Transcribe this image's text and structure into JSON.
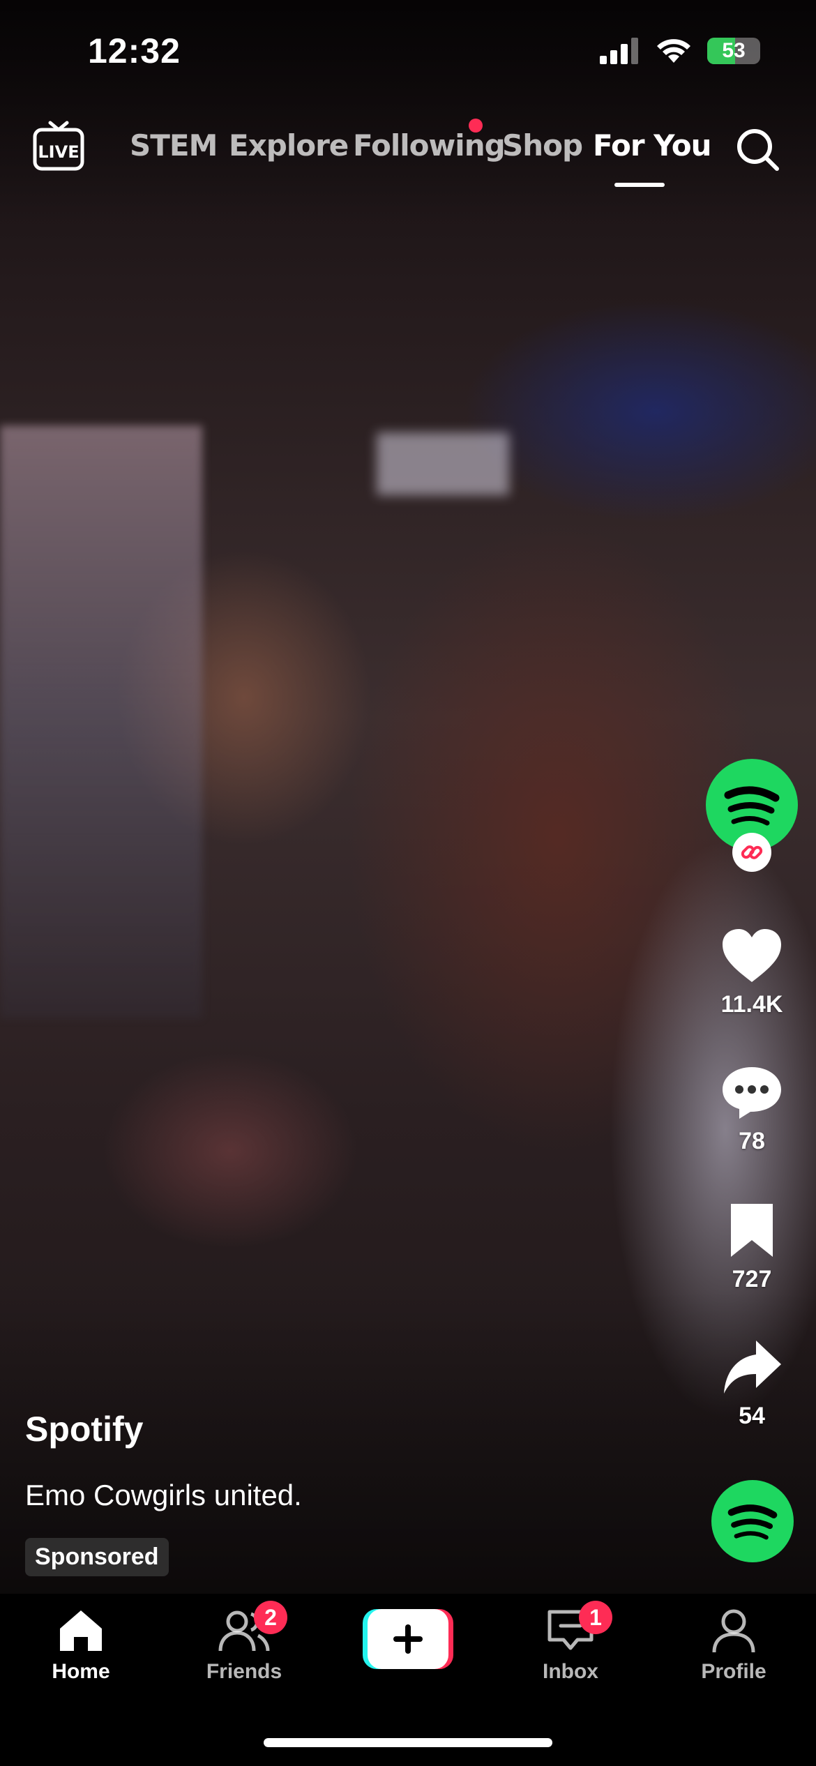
{
  "status_bar": {
    "time": "12:32",
    "battery": "53",
    "battery_level": 0.53
  },
  "top_nav": {
    "live_label": "LIVE",
    "tabs": [
      {
        "label": "STEM",
        "active": false
      },
      {
        "label": "Explore",
        "active": false
      },
      {
        "label": "Following",
        "active": false,
        "has_dot": true
      },
      {
        "label": "Shop",
        "active": false
      },
      {
        "label": "For You",
        "active": true
      }
    ]
  },
  "rail": {
    "likes": "11.4K",
    "comments": "78",
    "saves": "727",
    "shares": "54"
  },
  "post": {
    "author": "Spotify",
    "description": "Emo Cowgirls united.",
    "sponsored": "Sponsored"
  },
  "bottom_nav": {
    "home": "Home",
    "friends": "Friends",
    "friends_badge": "2",
    "inbox": "Inbox",
    "inbox_badge": "1",
    "profile": "Profile"
  },
  "colors": {
    "accent": "#fe2c55",
    "spotify_green": "#1ed760",
    "battery_green": "#34c759",
    "create_cyan": "#25f4ee"
  }
}
